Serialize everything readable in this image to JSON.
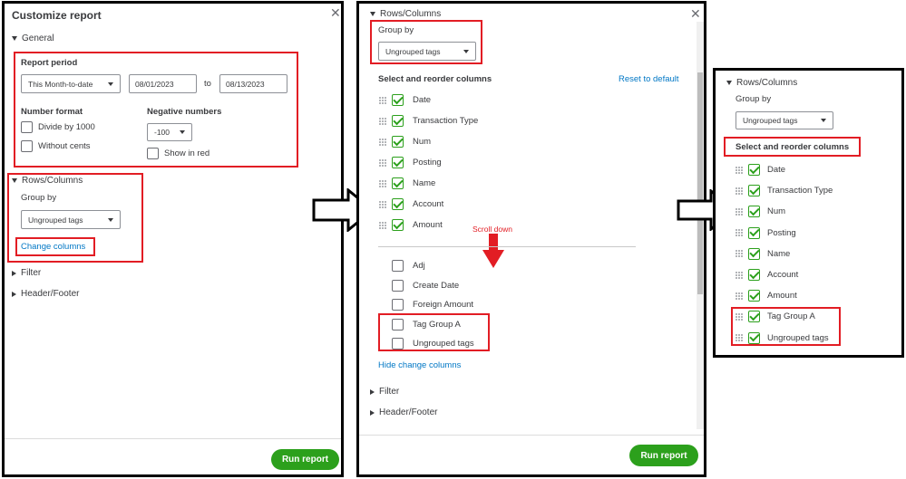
{
  "panel1": {
    "title": "Customize report",
    "general": "General",
    "report_period_label": "Report period",
    "period_select": "This Month-to-date",
    "date_from": "08/01/2023",
    "to_label": "to",
    "date_to": "08/13/2023",
    "number_format_label": "Number format",
    "divide_by_1000": "Divide by 1000",
    "without_cents": "Without cents",
    "negative_numbers_label": "Negative numbers",
    "negative_select": "-100",
    "show_in_red": "Show in red",
    "rows_columns": "Rows/Columns",
    "group_by_label": "Group by",
    "group_by_select": "Ungrouped tags",
    "change_columns": "Change columns",
    "filter": "Filter",
    "header_footer": "Header/Footer",
    "run_report": "Run report"
  },
  "panel2": {
    "rows_columns": "Rows/Columns",
    "group_by_label": "Group by",
    "group_by_select": "Ungrouped tags",
    "select_reorder": "Select and reorder columns",
    "reset_default": "Reset to default",
    "checked_columns": [
      "Date",
      "Transaction Type",
      "Num",
      "Posting",
      "Name",
      "Account",
      "Amount"
    ],
    "scroll_note": "Scroll down",
    "unchecked_columns": [
      "Adj",
      "Create Date",
      "Foreign Amount",
      "Tag Group A",
      "Ungrouped tags"
    ],
    "hide_change_columns": "Hide change columns",
    "filter": "Filter",
    "header_footer": "Header/Footer",
    "run_report": "Run report"
  },
  "panel3": {
    "rows_columns": "Rows/Columns",
    "group_by_label": "Group by",
    "group_by_select": "Ungrouped tags",
    "select_reorder": "Select and reorder columns",
    "checked_columns": [
      "Date",
      "Transaction Type",
      "Num",
      "Posting",
      "Name",
      "Account",
      "Amount",
      "Tag Group A",
      "Ungrouped tags"
    ]
  },
  "colors": {
    "accent_green": "#2ca01c",
    "link_blue": "#0077c5",
    "annotation_red": "#e21d24"
  },
  "icons": {
    "close": "close-icon",
    "expand": "triangle-down-icon",
    "collapsed": "triangle-right-icon",
    "drag": "drag-handle-icon",
    "flow_arrow": "right-arrow-icon",
    "scroll_arrow": "down-arrow-icon"
  }
}
